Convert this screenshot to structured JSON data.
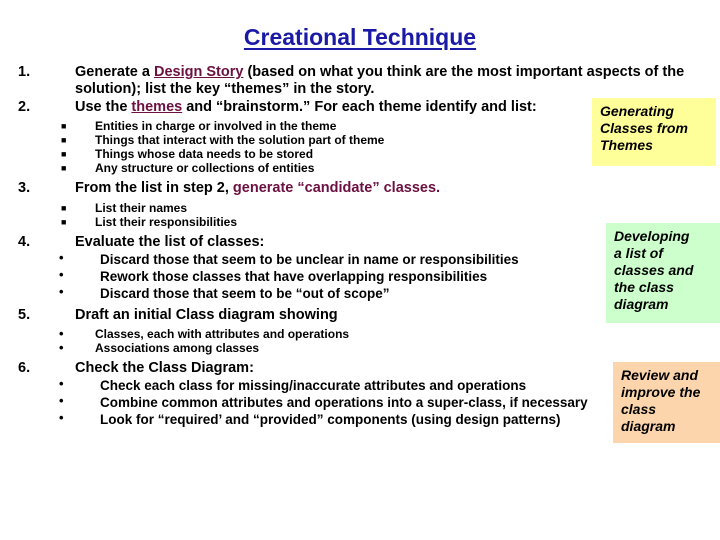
{
  "slide": {
    "title": "Creational Technique",
    "title_color": "#1a1aa6",
    "link_color": "#6b1040",
    "steps": [
      {
        "number": "1.",
        "text_before": "Generate a ",
        "link": "Design Story",
        "text_after": " (based on what you think are the most important aspects of the solution); list the key “themes” in the story.",
        "bullets": []
      },
      {
        "number": "2.",
        "text_before": "Use the ",
        "link": "themes",
        "text_after": " and “brainstorm.” For each theme identify and list:",
        "bullets": [
          "Entities in charge or involved in the theme",
          "Things that interact with the solution part of theme",
          "Things whose data needs to be stored",
          "Any structure or collections of entities"
        ]
      },
      {
        "number": "3.",
        "text_before": "From the list in step 2, ",
        "highlight": "generate “candidate” classes.",
        "text_after": "",
        "bullets": [
          "List their names",
          "List their responsibilities"
        ]
      },
      {
        "number": "4.",
        "text_before": "Evaluate the list of classes:",
        "bullets": [
          "Discard those that seem to be unclear in name or responsibilities",
          "Rework those classes that have overlapping responsibilities",
          "Discard those that seem to be “out of scope”"
        ]
      },
      {
        "number": "5.",
        "text_before": "Draft an initial Class diagram showing",
        "bullets": [
          "Classes, each with attributes and operations",
          "Associations among classes"
        ]
      },
      {
        "number": "6.",
        "text_before": "Check the Class Diagram:",
        "bullets": [
          "Check each class for missing/inaccurate attributes and operations",
          "Combine common attributes and operations into a super-class, if necessary",
          "Look for “required’ and “provided” components (using design patterns)"
        ]
      }
    ],
    "callouts": [
      {
        "id": "generating-classes-from-themes",
        "color": "#ffff99",
        "lines": [
          "Generating",
          "Classes from",
          "Themes"
        ]
      },
      {
        "id": "developing-list-of-classes",
        "color": "#ccffcc",
        "lines": [
          "Developing",
          "a list of",
          "classes and",
          "the class",
          "diagram"
        ]
      },
      {
        "id": "review-improve-class-diagram",
        "color": "#fcd5ac",
        "lines": [
          "Review and",
          "improve the",
          "class",
          "diagram"
        ]
      }
    ]
  }
}
